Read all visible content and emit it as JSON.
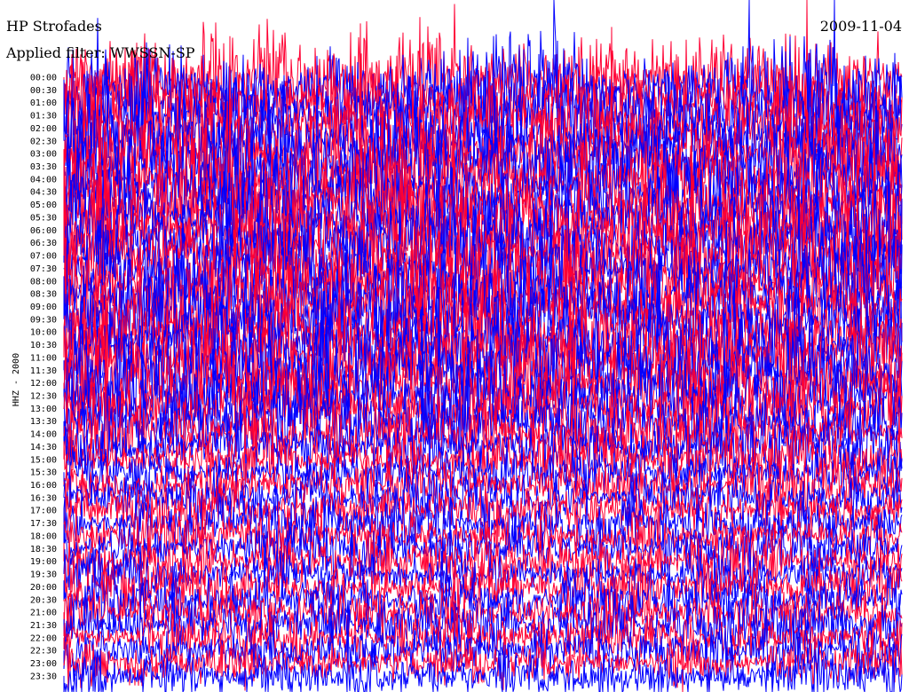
{
  "header": {
    "station": "HP Strofades",
    "filter": "Applied filter: WWSSN-SP",
    "date": "2009-11-04",
    "channel": "HHZ - 2000"
  },
  "colors": {
    "trace_a": "#ff0033",
    "trace_b": "#0000ff",
    "background": "#ffffff",
    "text": "#000000"
  },
  "chart_data": {
    "type": "line",
    "title": "HP Strofades",
    "subtitle": "Applied filter: WWSSN-SP",
    "date": "2009-11-04",
    "ylabel": "HHZ - 2000",
    "row_minutes": 30,
    "rows": [
      "00:00",
      "00:30",
      "01:00",
      "01:30",
      "02:00",
      "02:30",
      "03:00",
      "03:30",
      "04:00",
      "04:30",
      "05:00",
      "05:30",
      "06:00",
      "06:30",
      "07:00",
      "07:30",
      "08:00",
      "08:30",
      "09:00",
      "09:30",
      "10:00",
      "10:30",
      "11:00",
      "11:30",
      "12:00",
      "12:30",
      "13:00",
      "13:30",
      "14:00",
      "14:30",
      "15:00",
      "15:30",
      "16:00",
      "16:30",
      "17:00",
      "17:30",
      "18:00",
      "18:30",
      "19:00",
      "19:30",
      "20:00",
      "20:30",
      "21:00",
      "21:30",
      "22:00",
      "22:30",
      "23:00",
      "23:30"
    ],
    "series": [
      {
        "color": "#ff0033"
      },
      {
        "color": "#0000ff"
      }
    ],
    "row_colors": [
      "#ff0033",
      "#0000ff"
    ],
    "relative_amplitude": [
      9,
      9,
      9,
      9,
      9,
      9,
      9,
      9,
      9,
      9,
      9,
      9,
      9,
      9,
      9,
      9,
      9,
      9,
      9,
      9,
      9,
      9,
      9,
      9,
      8.5,
      8,
      7.5,
      7,
      6.5,
      6,
      5.5,
      5,
      5,
      5,
      5,
      5,
      5,
      5,
      5,
      5,
      5,
      5,
      5,
      5,
      5,
      5,
      5,
      5
    ],
    "grid": false
  }
}
